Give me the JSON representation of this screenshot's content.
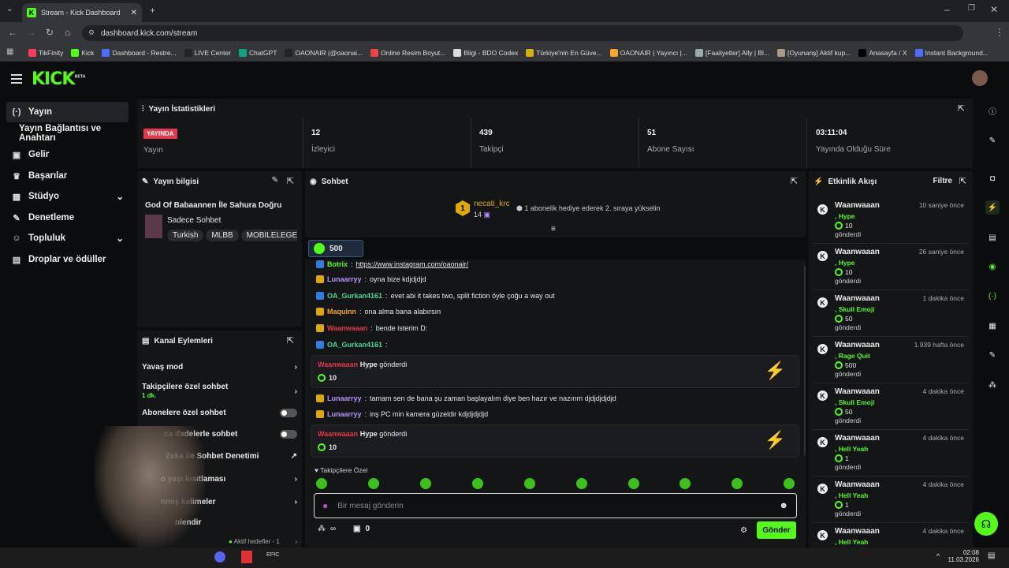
{
  "browser": {
    "tab_title": "Stream - Kick Dashboard",
    "url": "dashboard.kick.com/stream",
    "bookmarks": [
      "TikFinity",
      "Kick",
      "Dashboard - Restre...",
      "LIVE Center",
      "ChatGPT",
      "OAONAIR (@oaonai...",
      "Online Resim Boyut...",
      "Bilgi - BDO Codex",
      "Türkiye'nin En Güve...",
      "OAONAIR | Yayıncı |...",
      "[Faaliyetler] Ally | Bl...",
      "[Oyunanş] Aktif kup...",
      "Anasayfa / X",
      "Instant Background..."
    ]
  },
  "app": {
    "logo": "KICK",
    "logo_sup": "BETA"
  },
  "sidebar": {
    "items": [
      {
        "label": "Yayın",
        "icon": "broadcast-icon"
      },
      {
        "label": "Yayın Bağlantısı ve Anahtarı",
        "icon": ""
      },
      {
        "label": "Gelir",
        "icon": "money-icon"
      },
      {
        "label": "Başarılar",
        "icon": "trophy-icon"
      },
      {
        "label": "Stüdyo",
        "icon": "grid-icon"
      },
      {
        "label": "Denetleme",
        "icon": "wrench-icon"
      },
      {
        "label": "Topluluk",
        "icon": "people-icon"
      },
      {
        "label": "Droplar ve ödüller",
        "icon": "gift-icon"
      }
    ]
  },
  "stats": {
    "title": "Yayın İstatistikleri",
    "live_badge": "YAYINDA",
    "live_label": "Yayın",
    "viewers": "12",
    "viewers_label": "İzleyici",
    "followers": "439",
    "followers_label": "Takipçi",
    "subs": "51",
    "subs_label": "Abone Sayısı",
    "uptime": "03:11:04",
    "uptime_label": "Yayında Olduğu Süre"
  },
  "info": {
    "title": "Yayın bilgisi",
    "stream_title": "God Of Babaannen İle Sahura Doğru",
    "category": "Sadece Sohbet",
    "tags": [
      "Turkish",
      "MLBB",
      "MOBILELEGEN"
    ]
  },
  "actions": {
    "title": "Kanal Eylemleri",
    "slow": "Yavaş mod",
    "followers_only": "Takipçilere özel sohbet",
    "followers_only_sub": "1 dk.",
    "subs_only": "Abonelere özel sohbet",
    "emote_only": "ca ifadelerle sohbet",
    "ai_mod": "Zeka ile Sohbet Denetimi",
    "age": "o yaşı kısıtlaması",
    "words": "nmış kelimeler",
    "bots": "nlendir",
    "goals": "Aktif hedefler - 1"
  },
  "chat": {
    "title": "Sohbet",
    "pinned_user": "necati_krc",
    "pinned_count": "14",
    "pinned_rank": "1",
    "pinned_text": "1 abonelik hediye ederek 2. sıraya yükselin",
    "kicks_balance": "500",
    "messages": [
      {
        "user": "Botrix",
        "color": "#53fc18",
        "text": "https://www.instagram.com/oaonair/"
      },
      {
        "user": "Lunaarryy",
        "color": "#b690ff",
        "text": "oyna bize kdjdjdjd"
      },
      {
        "user": "OA_Gurkan4161",
        "color": "#3fd89a",
        "text": "evet abi it takes two, split fiction öyle çoğu a way out"
      },
      {
        "user": "Maquinn",
        "color": "#f5a623",
        "text": "ona alma bana alabırsın"
      },
      {
        "user": "Waanwaaan",
        "color": "#e5364b",
        "text": "bende isterim D:"
      },
      {
        "user": "OA_Gurkan4161",
        "color": "#3fd89a",
        "text": ""
      }
    ],
    "gift1": {
      "user": "Waanwaaan",
      "item": "Hype",
      "verb": "gönderdi",
      "amount": "10"
    },
    "messages2": [
      {
        "user": "Lunaarryy",
        "color": "#b690ff",
        "text": "tamam sen de bana şu zaman başlayalım diye ben hazır ve nazırım djdjdjdjdjd"
      },
      {
        "user": "Lunaarryy",
        "color": "#b690ff",
        "text": "inş PC min kamera güzeldir kdjdjdjdjd"
      }
    ],
    "gift2": {
      "user": "Waanwaaan",
      "item": "Hype",
      "verb": "gönderdi",
      "amount": "10"
    },
    "followers_only_label": "Takipçilere Özel",
    "input_placeholder": "Bir mesaj gönderin",
    "points": "∞",
    "gift_count": "0",
    "send": "Gönder"
  },
  "events": {
    "title": "Etkinlik Akışı",
    "filter": "Filtre",
    "items": [
      {
        "user": "Waanwaaan",
        "time": "10 saniye önce",
        "gift": "Hype",
        "amount": "10",
        "verb": "gönderdi"
      },
      {
        "user": "Waanwaaan",
        "time": "26 saniye önce",
        "gift": "Hype",
        "amount": "10",
        "verb": "gönderdi"
      },
      {
        "user": "Waanwaaan",
        "time": "1 dakika önce",
        "gift": "Skull Emoji",
        "amount": "50",
        "verb": "gönderdi"
      },
      {
        "user": "Waanwaaan",
        "time": "1.939 hafta önce",
        "gift": "Rage Quit",
        "amount": "500",
        "verb": "gönderdi"
      },
      {
        "user": "Waanwaaan",
        "time": "4 dakika önce",
        "gift": "Skull Emoji",
        "amount": "50",
        "verb": "gönderdi"
      },
      {
        "user": "Waanwaaan",
        "time": "4 dakika önce",
        "gift": "Hell Yeah",
        "amount": "1",
        "verb": "gönderdi"
      },
      {
        "user": "Waanwaaan",
        "time": "4 dakika önce",
        "gift": "Hell Yeah",
        "amount": "1",
        "verb": "gönderdi"
      },
      {
        "user": "Waanwaaan",
        "time": "4 dakika önce",
        "gift": "Hell Yeah",
        "amount": "",
        "verb": ""
      }
    ]
  },
  "taskbar": {
    "time": "02:08",
    "date": "11.03.2026"
  },
  "colors": {
    "accent": "#53fc18",
    "live": "#e5364b"
  }
}
